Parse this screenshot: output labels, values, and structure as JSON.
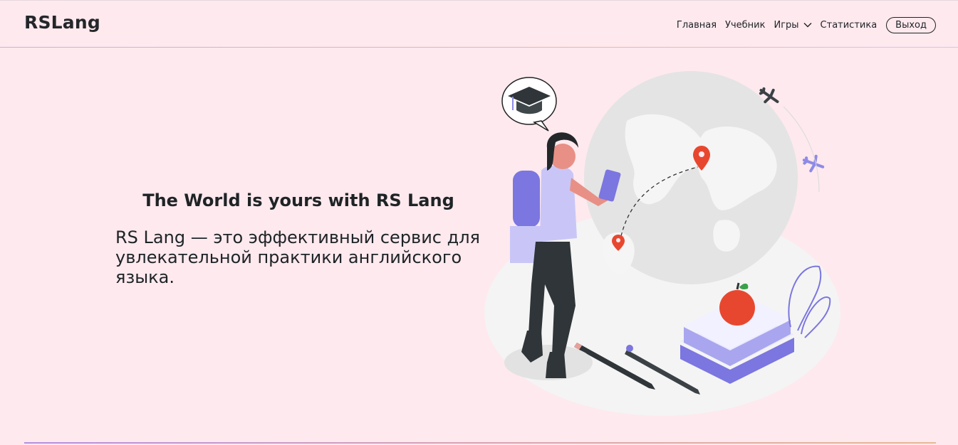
{
  "header": {
    "logo": "RSLang",
    "nav": {
      "home": "Главная",
      "textbook": "Учебник",
      "games": "Игры",
      "stats": "Статистика",
      "logout": "Выход"
    }
  },
  "hero": {
    "title": "The World is yours with RS Lang",
    "text": "RS Lang — это эффективный сервис для увлекательной практики английского языка."
  },
  "colors": {
    "background": "#fde9ee",
    "accent_purple": "#7b76e0",
    "accent_red": "#e8472f"
  }
}
